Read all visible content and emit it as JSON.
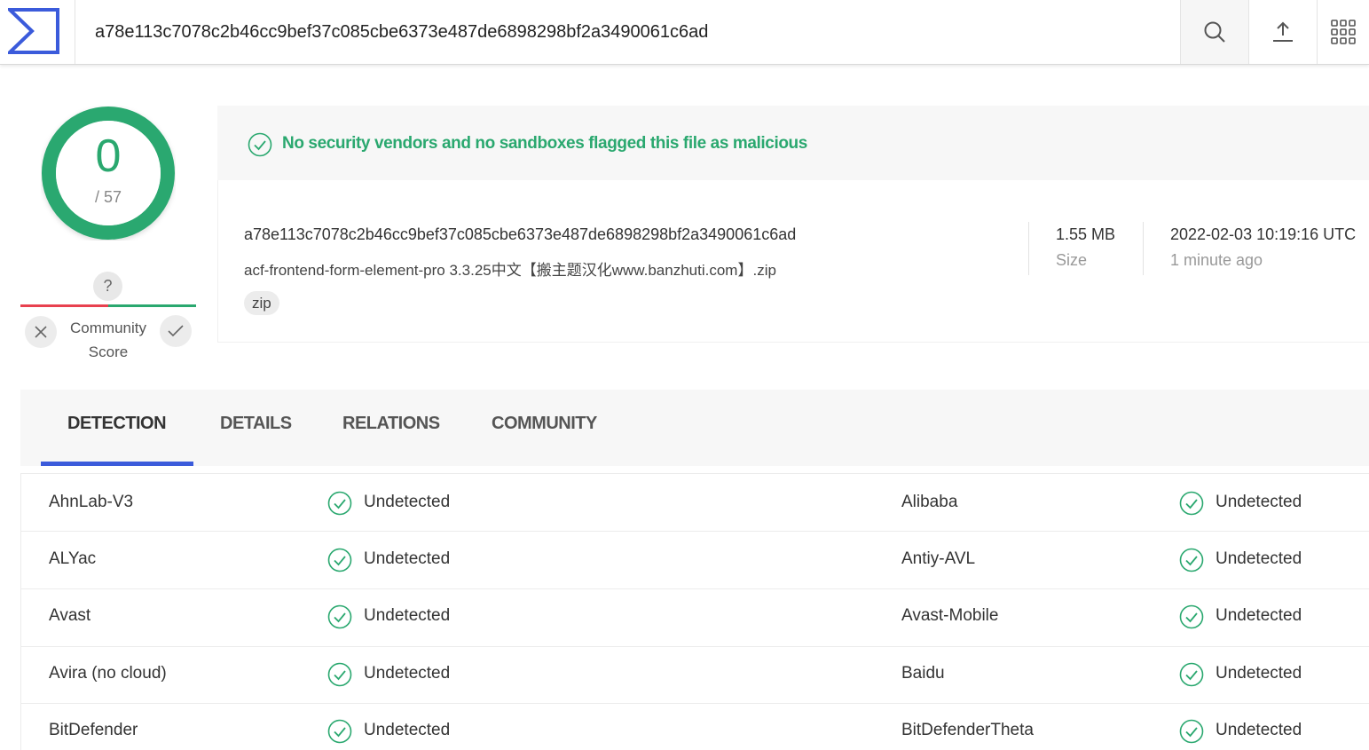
{
  "search": {
    "value": "a78e113c7078c2b46cc9bef37c085cbe6373e487de6898298bf2a3490061c6ad"
  },
  "toolbar": {
    "search_icon": "search-icon",
    "upload_icon": "upload-icon",
    "apps_icon": "apps-grid-icon"
  },
  "score": {
    "detections": "0",
    "total": "/ 57",
    "ring_color": "#2aa86f"
  },
  "community": {
    "question": "?",
    "label_line1": "Community",
    "label_line2": "Score"
  },
  "banner": {
    "text": "No security vendors and no sandboxes flagged this file as malicious",
    "color": "#2aa86f"
  },
  "file": {
    "hash": "a78e113c7078c2b46cc9bef37c085cbe6373e487de6898298bf2a3490061c6ad",
    "name": "acf-frontend-form-element-pro 3.3.25中文【搬主题汉化www.banzhuti.com】.zip",
    "tag": "zip",
    "size_value": "1.55 MB",
    "size_label": "Size",
    "date_value": "2022-02-03 10:19:16 UTC",
    "date_label": "1 minute ago"
  },
  "tabs": [
    {
      "label": "DETECTION"
    },
    {
      "label": "DETAILS"
    },
    {
      "label": "RELATIONS"
    },
    {
      "label": "COMMUNITY"
    }
  ],
  "accent": "#3b5bdb",
  "detections": [
    {
      "left": {
        "vendor": "AhnLab-V3",
        "result": "Undetected"
      },
      "right": {
        "vendor": "Alibaba",
        "result": "Undetected"
      }
    },
    {
      "left": {
        "vendor": "ALYac",
        "result": "Undetected"
      },
      "right": {
        "vendor": "Antiy-AVL",
        "result": "Undetected"
      }
    },
    {
      "left": {
        "vendor": "Avast",
        "result": "Undetected"
      },
      "right": {
        "vendor": "Avast-Mobile",
        "result": "Undetected"
      }
    },
    {
      "left": {
        "vendor": "Avira (no cloud)",
        "result": "Undetected"
      },
      "right": {
        "vendor": "Baidu",
        "result": "Undetected"
      }
    },
    {
      "left": {
        "vendor": "BitDefender",
        "result": "Undetected"
      },
      "right": {
        "vendor": "BitDefenderTheta",
        "result": "Undetected"
      }
    }
  ]
}
